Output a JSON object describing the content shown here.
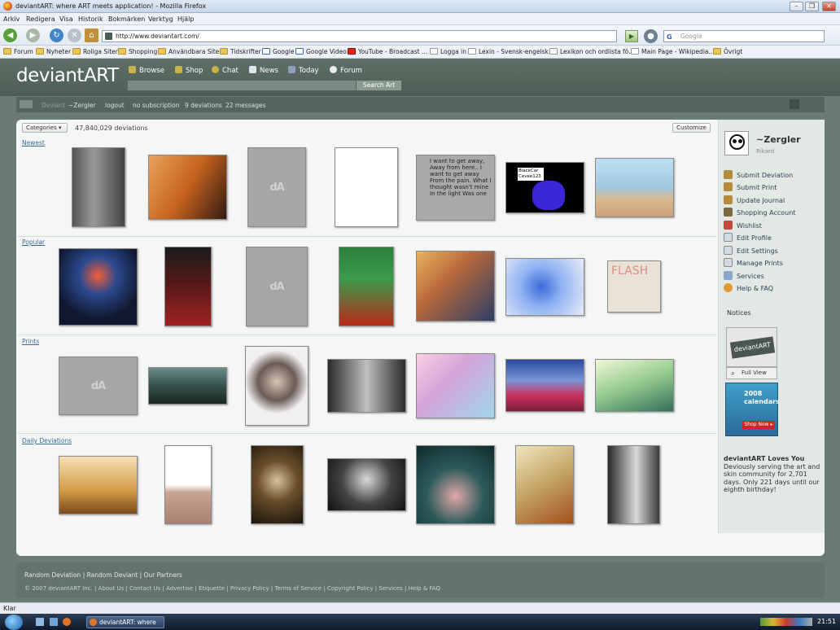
{
  "window": {
    "title": "deviantART: where ART meets application! - Mozilla Firefox"
  },
  "menu": [
    "Arkiv",
    "Redigera",
    "Visa",
    "Historik",
    "Bokmärken",
    "Verktyg",
    "Hjälp"
  ],
  "nav": {
    "url": "http://www.deviantart.com/",
    "search_placeholder": "Google",
    "search_engine_glyph": "G"
  },
  "bookmarks": [
    {
      "label": "Forum",
      "type": "folder"
    },
    {
      "label": "Nyheter",
      "type": "folder"
    },
    {
      "label": "Roliga Siter",
      "type": "folder"
    },
    {
      "label": "Shopping",
      "type": "folder"
    },
    {
      "label": "Användbara Siter",
      "type": "folder"
    },
    {
      "label": "Tidskrifter",
      "type": "folder"
    },
    {
      "label": "Google",
      "type": "google"
    },
    {
      "label": "Google Video",
      "type": "google"
    },
    {
      "label": "YouTube - Broadcast ...",
      "type": "youtube"
    },
    {
      "label": "Logga in",
      "type": "page"
    },
    {
      "label": "Lexin - Svensk-engelsk...",
      "type": "page"
    },
    {
      "label": "Lexikon och ordlista fö...",
      "type": "page"
    },
    {
      "label": "Main Page - Wikipedia...",
      "type": "page"
    },
    {
      "label": "Övrigt",
      "type": "folder"
    }
  ],
  "da": {
    "logo": "deviantART",
    "nav": [
      "Browse",
      "Shop",
      "Chat",
      "News",
      "Today",
      "Forum"
    ],
    "search_button": "Search Art",
    "userbar": {
      "rank": "Deviant",
      "user": "~Zergler",
      "logout": "logout",
      "subscription": "no subscription",
      "deviations": "9 deviations",
      "messages": "22 messages"
    }
  },
  "main": {
    "categories_label": "Categories ▾",
    "count": "47,840,029 deviations",
    "customize": "Customize",
    "sections": [
      "Newest",
      "Popular",
      "Prints",
      "Daily Deviations"
    ],
    "placeholder_logo": "dA",
    "thumb_text": {
      "journal": "I want to get away, Away from here.. I want to get away From the pain. What I thought wasn't mine In the light Was one",
      "blackcar": "BlackCar Cevee123",
      "flash": "FLASH"
    }
  },
  "sidebar": {
    "username": "~Zergler",
    "realname": "Rikard",
    "menu": [
      "Submit Deviation",
      "Submit Print",
      "Update Journal",
      "Wishlist",
      "Shopping Account",
      "Edit Profile",
      "Edit Settings",
      "Manage Prints",
      "Services",
      "Help & FAQ"
    ],
    "notices": "Notices",
    "full_view": "Full View",
    "notice_print_title": "deviantART",
    "calendar": {
      "title": "2008 calendars",
      "button": "Shop Now ▸"
    },
    "loves_title": "deviantART Loves You",
    "loves_text": "Deviously serving the art and skin community for 2,701 days. Only 221 days until our eighth birthday!"
  },
  "footer": {
    "line1": "Random Deviation | Random Deviant | Our Partners",
    "line2": "© 2007 deviantART Inc. | About Us | Contact Us | Advertise | Etiquette | Privacy Policy | Terms of Service | Copyright Policy | Services | Help & FAQ"
  },
  "status": {
    "text": "Klar"
  },
  "taskbar": {
    "item": "deviantART: where A...",
    "clock": "21:51"
  }
}
